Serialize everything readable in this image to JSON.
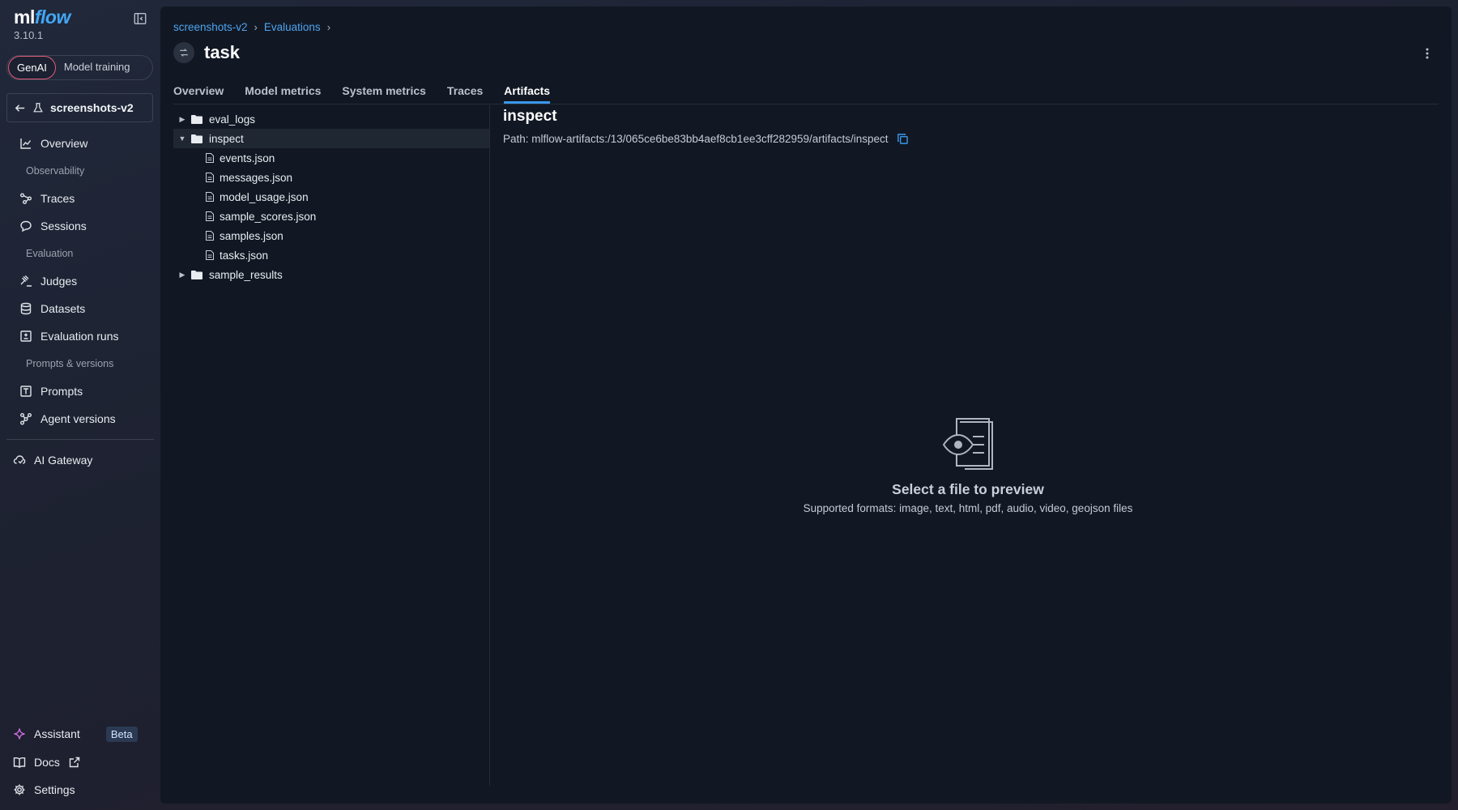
{
  "brand": {
    "ml": "ml",
    "flow": "flow",
    "version": "3.10.1"
  },
  "mode_toggle": {
    "genai": "GenAI",
    "model_training": "Model training"
  },
  "experiment": {
    "name": "screenshots-v2"
  },
  "nav": {
    "overview": "Overview",
    "section_observability": "Observability",
    "traces": "Traces",
    "sessions": "Sessions",
    "section_evaluation": "Evaluation",
    "judges": "Judges",
    "datasets": "Datasets",
    "evaluation_runs": "Evaluation runs",
    "section_prompts": "Prompts & versions",
    "prompts": "Prompts",
    "agent_versions": "Agent versions",
    "ai_gateway": "AI Gateway",
    "assistant": "Assistant",
    "beta": "Beta",
    "docs": "Docs",
    "settings": "Settings"
  },
  "breadcrumb": {
    "first": "screenshots-v2",
    "second": "Evaluations"
  },
  "page": {
    "title": "task"
  },
  "tabs": [
    "Overview",
    "Model metrics",
    "System metrics",
    "Traces",
    "Artifacts"
  ],
  "tree": {
    "eval_logs": "eval_logs",
    "inspect": "inspect",
    "files": [
      "events.json",
      "messages.json",
      "model_usage.json",
      "sample_scores.json",
      "samples.json",
      "tasks.json"
    ],
    "sample_results": "sample_results"
  },
  "preview": {
    "title": "inspect",
    "path": "Path: mlflow-artifacts:/13/065ce6be83bb4aef8cb1ee3cff282959/artifacts/inspect",
    "empty_title": "Select a file to preview",
    "empty_sub": "Supported formats: image, text, html, pdf, audio, video, geojson files"
  },
  "colors": {
    "accent": "#3b97ea",
    "link": "#4fa3f0",
    "panel": "#111823",
    "genai_border": "#e05a7a"
  }
}
